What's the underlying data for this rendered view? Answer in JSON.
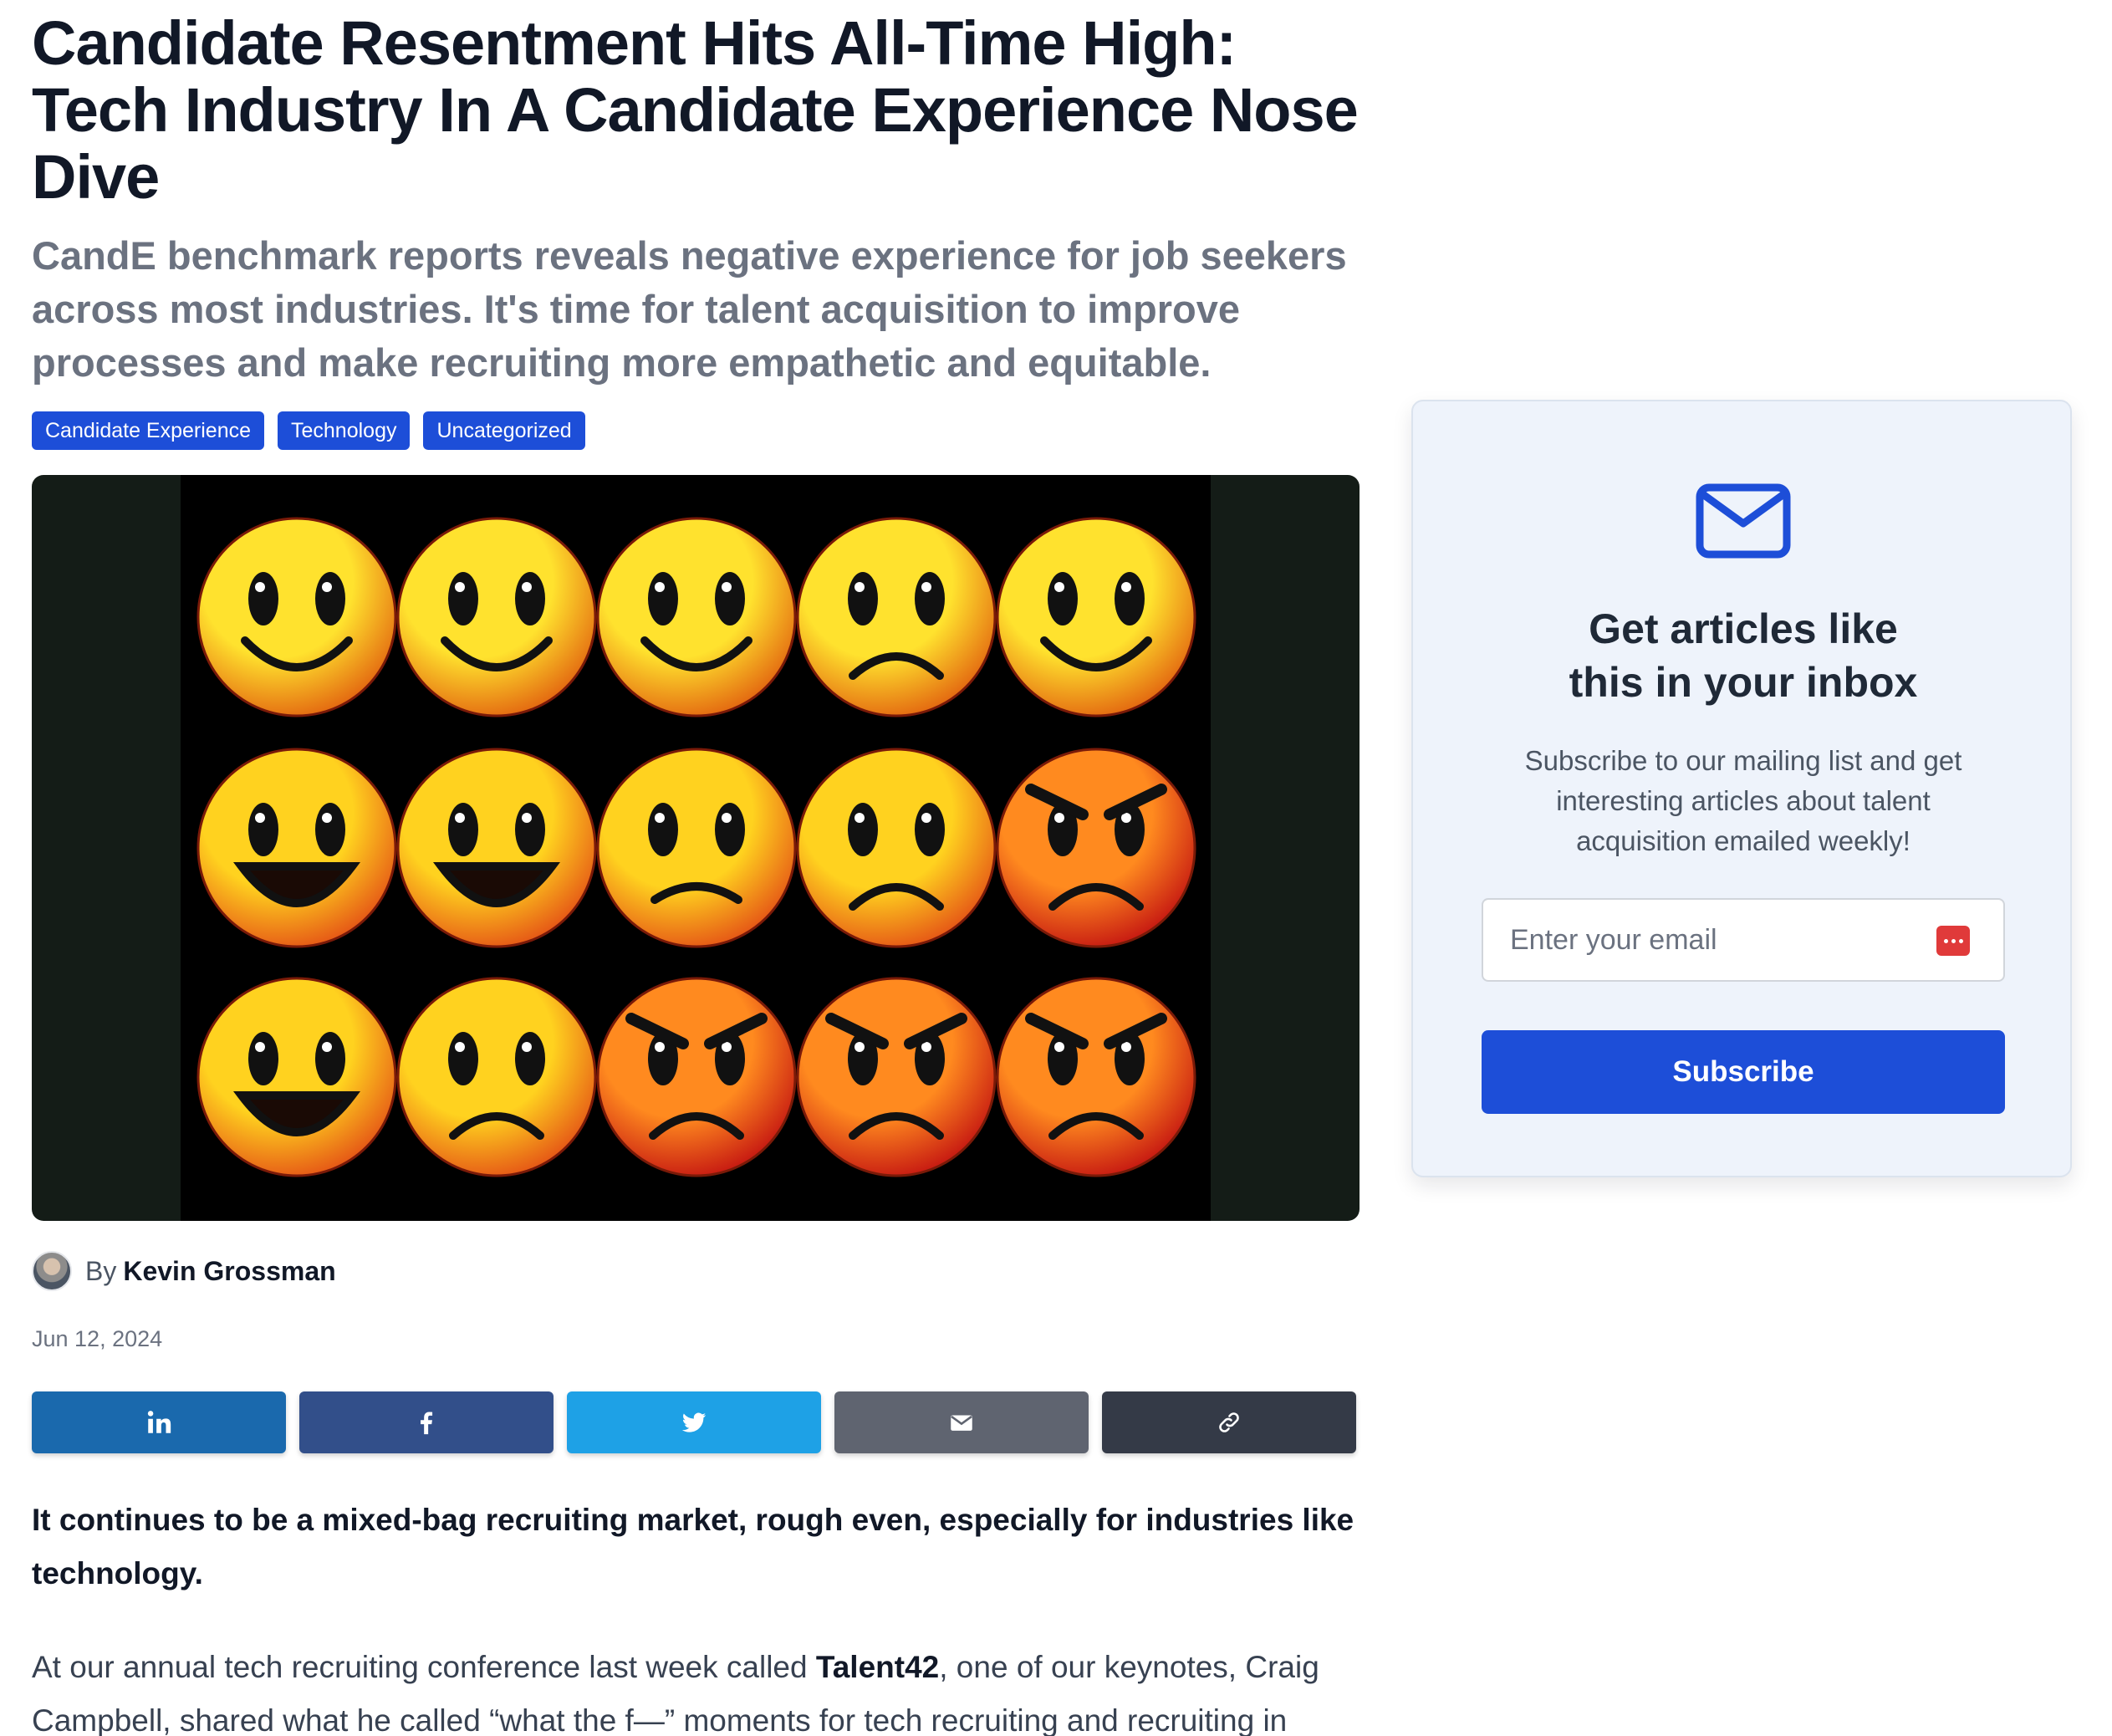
{
  "article": {
    "title": "Candidate Resentment Hits All-Time High: Tech Industry In A Candidate Experience Nose Dive",
    "subtitle": "CandE benchmark reports reveals negative experience for job seekers across most industries. It's time for talent acquisition to improve processes and make recruiting more empathetic and equitable.",
    "tags": [
      "Candidate Experience",
      "Technology",
      "Uncategorized"
    ],
    "hero_image": "grid of fifteen emoji faces ranging from happy to angry",
    "byline_prefix": "By",
    "author": "Kevin Grossman",
    "date": "Jun 12, 2024",
    "share_icons": [
      "linkedin-icon",
      "facebook-icon",
      "twitter-icon",
      "email-icon",
      "link-icon"
    ],
    "lead": "It continues to be a mixed-bag recruiting market, rough even, especially for industries like technology.",
    "body_p1_start": "At our annual tech recruiting conference last week called ",
    "body_p1_link": "Talent42",
    "body_p1_end": ", one of our keynotes, Craig Campbell, shared what he called “what the f—” moments for tech recruiting and recruiting in general:"
  },
  "sidebar": {
    "icon": "envelope-icon",
    "heading": "Get articles like this in your inbox",
    "description": "Subscribe to our mailing list and get interesting articles about talent acquisition emailed weekly!",
    "email_placeholder": "Enter your email",
    "subscribe_label": "Subscribe"
  },
  "colors": {
    "accent": "#1d4ed8",
    "linkedin": "#1a69ad",
    "facebook": "#324f8a",
    "twitter": "#1ea1e6",
    "email": "#5f6470",
    "link": "#343a47"
  }
}
